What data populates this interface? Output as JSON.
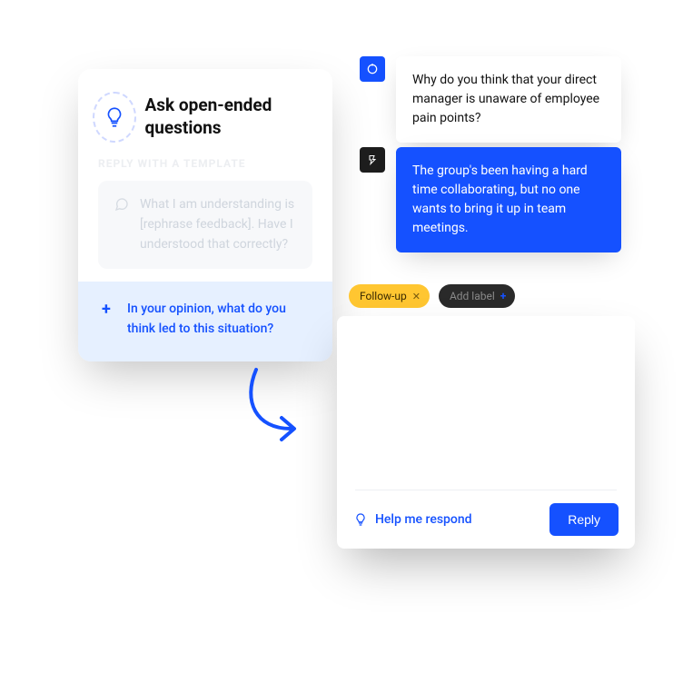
{
  "card": {
    "title": "Ask open-ended questions",
    "section_label": "REPLY WITH A TEMPLATE",
    "templates": [
      "What I am understanding is [rephrase feedback]. Have I understood that correctly?",
      "In your opinion, what do you think led to this situation?"
    ]
  },
  "chat": {
    "manager_msg": "Why do you think that your direct manager is unaware of employee pain points?",
    "employee_msg": "The group's been having a hard time collaborating, but no one wants to bring it up in team meetings."
  },
  "chips": {
    "followup": "Follow-up",
    "add_label": "Add label"
  },
  "reply": {
    "help": "Help me respond",
    "button": "Reply"
  }
}
